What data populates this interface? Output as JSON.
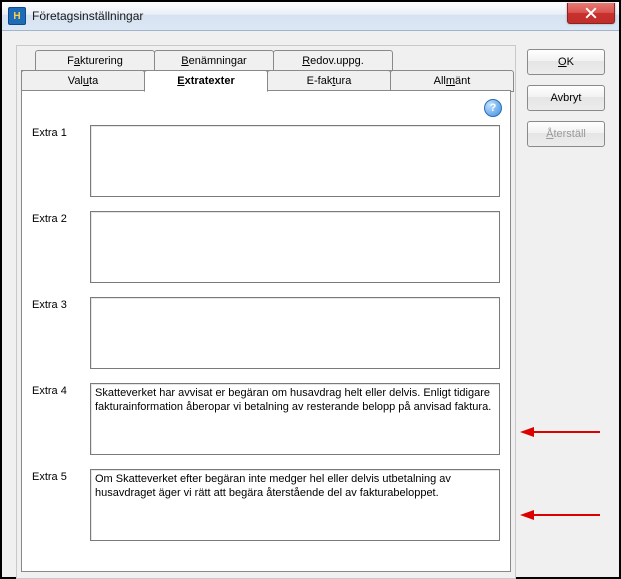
{
  "window": {
    "title": "Företagsinställningar"
  },
  "tabs_row1": {
    "fakturering": {
      "pre": "F",
      "u": "a",
      "post": "kturering"
    },
    "benamningar": {
      "pre": "",
      "u": "B",
      "post": "enämningar"
    },
    "redov": {
      "pre": "",
      "u": "R",
      "post": "edov.uppg."
    }
  },
  "tabs_row2": {
    "valuta": {
      "pre": "Val",
      "u": "u",
      "post": "ta"
    },
    "extratexter": {
      "pre": "",
      "u": "E",
      "post": "xtratexter"
    },
    "efaktura": {
      "pre": "E-fak",
      "u": "t",
      "post": "ura"
    },
    "allmant": {
      "pre": "All",
      "u": "m",
      "post": "änt"
    }
  },
  "fields": {
    "extra1": {
      "label": "Extra 1",
      "value": ""
    },
    "extra2": {
      "label": "Extra 2",
      "value": ""
    },
    "extra3": {
      "label": "Extra 3",
      "value": ""
    },
    "extra4": {
      "label": "Extra 4",
      "value": "Skatteverket har avvisat er begäran om husavdrag helt eller delvis. Enligt tidigare fakturainformation åberopar vi betalning av resterande belopp på anvisad faktura."
    },
    "extra5": {
      "label": "Extra 5",
      "value": "Om Skatteverket efter begäran inte medger hel eller delvis utbetalning av husavdraget äger vi rätt att begära återstående del av fakturabeloppet."
    }
  },
  "buttons": {
    "ok": {
      "pre": "",
      "u": "O",
      "post": "K"
    },
    "avbryt": {
      "label": "Avbryt"
    },
    "aterstall": {
      "pre": "",
      "u": "Å",
      "post": "terställ"
    }
  },
  "help": {
    "glyph": "?"
  }
}
